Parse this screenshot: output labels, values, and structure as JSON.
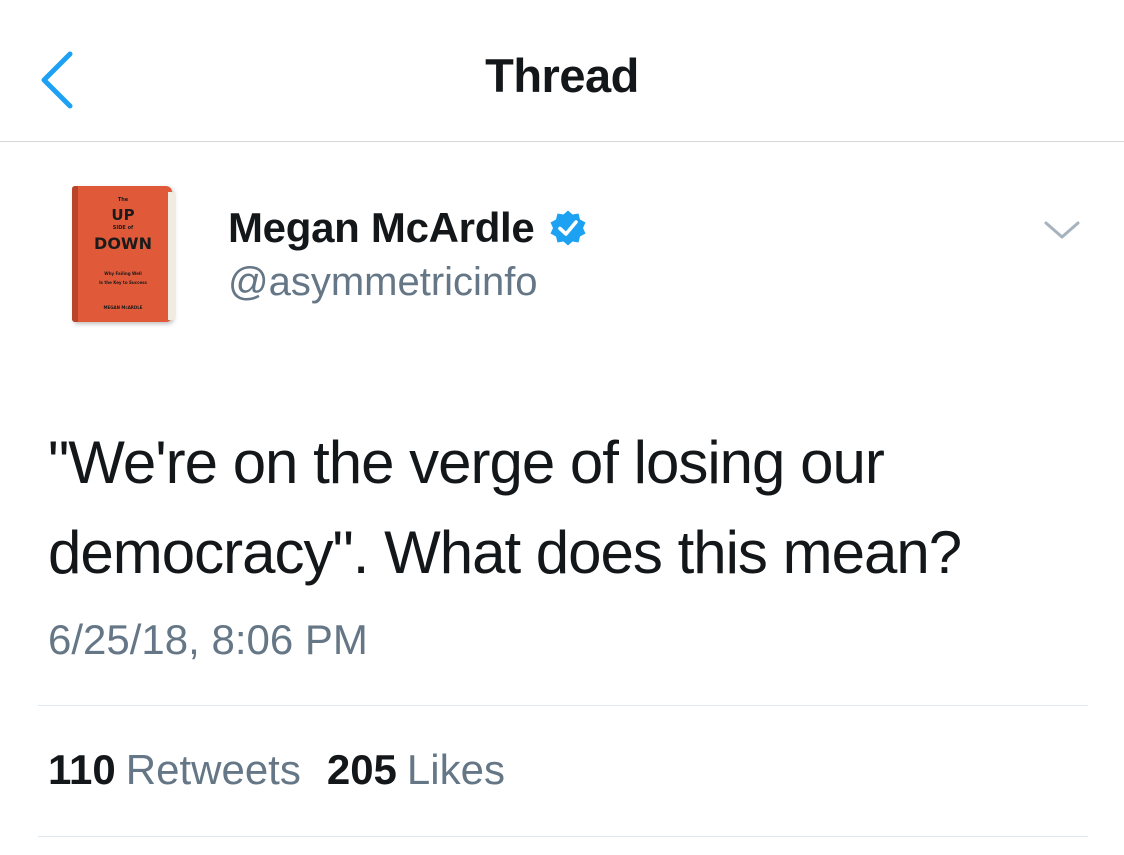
{
  "nav": {
    "title": "Thread",
    "back_icon": "chevron-left-icon",
    "accent_color": "#1da1f2"
  },
  "author": {
    "display_name": "Megan McArdle",
    "handle": "@asymmetricinfo",
    "verified": true,
    "verified_icon": "verified-badge-icon",
    "avatar": {
      "book_the": "The",
      "book_up": "UP",
      "book_side": "SIDE of",
      "book_down": "DOWN",
      "book_sub1": "Why Failing Well",
      "book_sub2": "Is the Key to Success",
      "book_author": "MEGAN McARDLE",
      "cover_color": "#e05a3a"
    }
  },
  "tweet": {
    "text": "\"We're on the verge of losing our democracy\". What does this mean?",
    "timestamp": "6/25/18, 8:06 PM",
    "menu_icon": "chevron-down-icon"
  },
  "stats": {
    "retweets_count": "110",
    "retweets_label": "Retweets",
    "likes_count": "205",
    "likes_label": "Likes"
  }
}
